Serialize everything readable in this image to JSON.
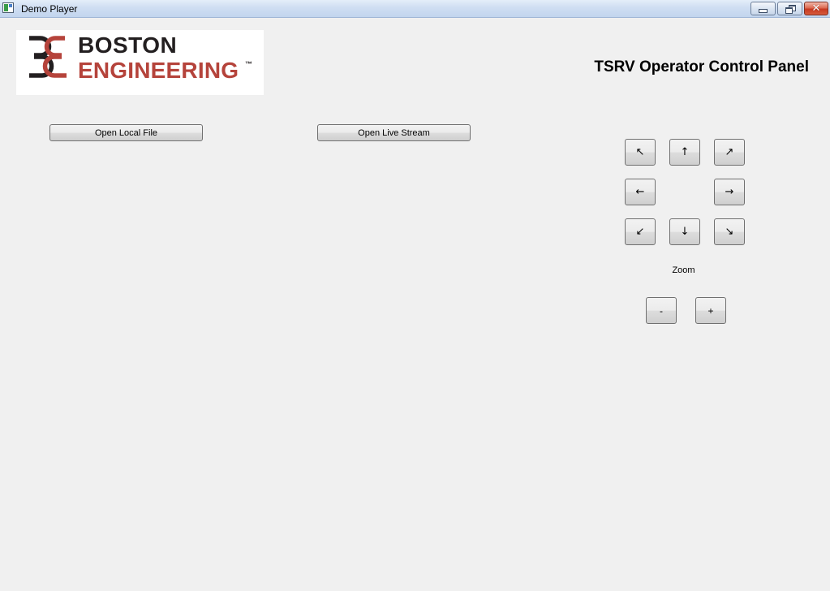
{
  "window": {
    "title": "Demo Player",
    "controls": {
      "minimize_icon": "minimize-icon",
      "maximize_icon": "restore-icon",
      "close_icon": "close-icon",
      "close_glyph": "✕"
    }
  },
  "logo": {
    "line1": "BOSTON",
    "line2": "ENGINEERING",
    "trademark": "™",
    "colors": {
      "dark": "#231f20",
      "accent": "#b5433b"
    }
  },
  "header": {
    "title": "TSRV Operator Control Panel"
  },
  "toolbar": {
    "open_local_label": "Open Local File",
    "open_stream_label": "Open Live Stream"
  },
  "direction_pad": {
    "up_left": "↖",
    "up": "↑",
    "up_right": "↗",
    "left": "←",
    "right": "→",
    "down_left": "↙",
    "down": "↓",
    "down_right": "↘"
  },
  "zoom": {
    "label": "Zoom",
    "minus": "-",
    "plus": "+"
  }
}
